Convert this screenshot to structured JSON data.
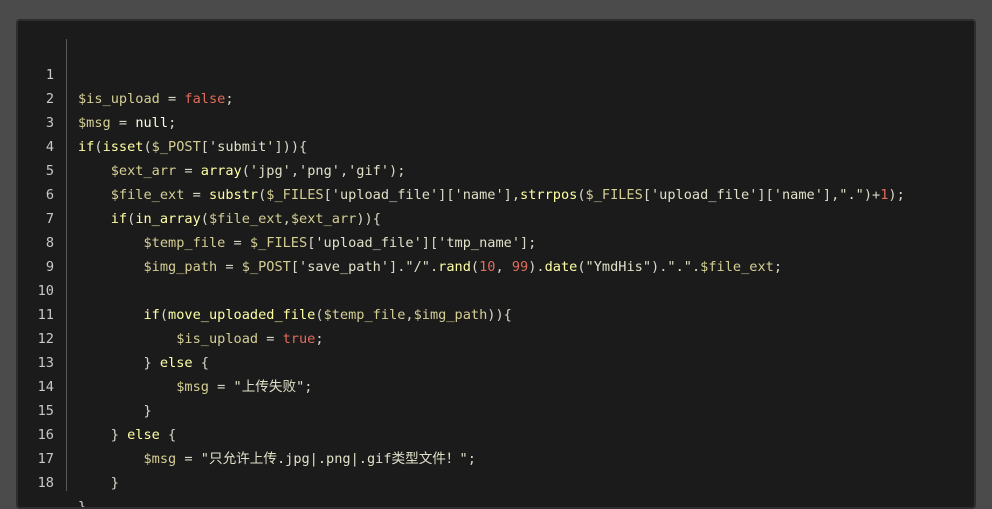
{
  "editor": {
    "language": "php",
    "theme": "dark",
    "line_numbers": [
      "1",
      "2",
      "3",
      "4",
      "5",
      "6",
      "7",
      "8",
      "9",
      "10",
      "11",
      "12",
      "13",
      "14",
      "15",
      "16",
      "17",
      "18"
    ],
    "lines": [
      "$is_upload = false;",
      "$msg = null;",
      "if(isset($_POST['submit'])){",
      "    $ext_arr = array('jpg','png','gif');",
      "    $file_ext = substr($_FILES['upload_file']['name'],strrpos($_FILES['upload_file']['name'],\".\")+1);",
      "    if(in_array($file_ext,$ext_arr)){",
      "        $temp_file = $_FILES['upload_file']['tmp_name'];",
      "        $img_path = $_POST['save_path'].\"/\".rand(10, 99).date(\"YmdHis\").\".\".$file_ext;",
      "",
      "        if(move_uploaded_file($temp_file,$img_path)){",
      "            $is_upload = true;",
      "        } else {",
      "            $msg = \"上传失败\";",
      "        }",
      "    } else {",
      "        $msg = \"只允许上传.jpg|.png|.gif类型文件！\";",
      "    }",
      "}"
    ]
  },
  "colors": {
    "background": "#1b1b1b",
    "frame": "#4b4b4b",
    "variable": "#d4ce94",
    "keyword": "#ffffa6",
    "number": "#e06c5c"
  }
}
